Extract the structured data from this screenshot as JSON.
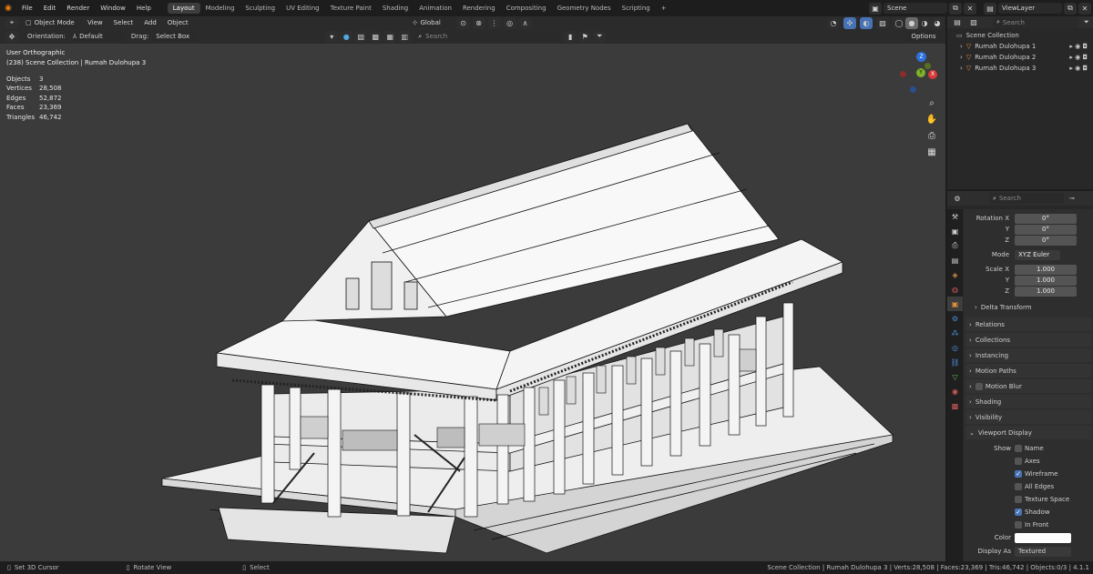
{
  "topbar": {
    "menus": [
      "File",
      "Edit",
      "Render",
      "Window",
      "Help"
    ],
    "workspaces": [
      "Layout",
      "Modeling",
      "Sculpting",
      "UV Editing",
      "Texture Paint",
      "Shading",
      "Animation",
      "Rendering",
      "Compositing",
      "Geometry Nodes",
      "Scripting"
    ],
    "active_workspace": "Layout",
    "add_tab": "+",
    "scene": "Scene",
    "view_layer": "ViewLayer"
  },
  "viewport_header": {
    "mode": "Object Mode",
    "menus": [
      "View",
      "Select",
      "Add",
      "Object"
    ],
    "transform": "Global",
    "search_placeholder": "Search",
    "options": "Options"
  },
  "tool_header": {
    "orientation_label": "Orientation:",
    "orientation_value": "Default",
    "drag_label": "Drag:",
    "drag_value": "Select Box"
  },
  "overlay": {
    "view_name": "User Orthographic",
    "context": "(238) Scene Collection | Rumah Dulohupa 3",
    "stats": [
      {
        "label": "Objects",
        "value": "3"
      },
      {
        "label": "Vertices",
        "value": "28,508"
      },
      {
        "label": "Edges",
        "value": "52,872"
      },
      {
        "label": "Faces",
        "value": "23,369"
      },
      {
        "label": "Triangles",
        "value": "46,742"
      }
    ]
  },
  "gizmo": {
    "x": "X",
    "y": "Y",
    "z": "Z"
  },
  "outliner": {
    "search_placeholder": "Search",
    "root": "Scene Collection",
    "items": [
      "Rumah Dulohupa 1",
      "Rumah Dulohupa 2",
      "Rumah Dulohupa 3"
    ]
  },
  "properties": {
    "search_placeholder": "Search",
    "rotation": {
      "label_x": "Rotation X",
      "label_y": "Y",
      "label_z": "Z",
      "x": "0°",
      "y": "0°",
      "z": "0°"
    },
    "mode_label": "Mode",
    "mode_value": "XYZ Euler",
    "scale": {
      "label_x": "Scale X",
      "label_y": "Y",
      "label_z": "Z",
      "x": "1.000",
      "y": "1.000",
      "z": "1.000"
    },
    "delta": "Delta Transform",
    "panels": [
      "Relations",
      "Collections",
      "Instancing",
      "Motion Paths",
      "Motion Blur",
      "Shading",
      "Visibility"
    ],
    "viewport_display": {
      "title": "Viewport Display",
      "show_label": "Show",
      "options": [
        {
          "name": "Name",
          "on": false
        },
        {
          "name": "Axes",
          "on": false
        },
        {
          "name": "Wireframe",
          "on": true
        },
        {
          "name": "All Edges",
          "on": false
        },
        {
          "name": "Texture Space",
          "on": false
        },
        {
          "name": "Shadow",
          "on": true
        },
        {
          "name": "In Front",
          "on": false
        }
      ],
      "color_label": "Color",
      "display_as_label": "Display As",
      "display_as_value": "Textured"
    }
  },
  "statusbar": {
    "left": [
      "Set 3D Cursor",
      "Rotate View",
      "Select"
    ],
    "right": "Scene Collection | Rumah Dulohupa 3 | Verts:28,508 | Faces:23,369 | Tris:46,742 | Objects:0/3 | 4.1.1"
  },
  "colors": {
    "accent": "#4772b3",
    "active_object": "#e6923a",
    "viewport_bg": "#3b3b3b",
    "panel_bg": "#2e2e2e"
  }
}
